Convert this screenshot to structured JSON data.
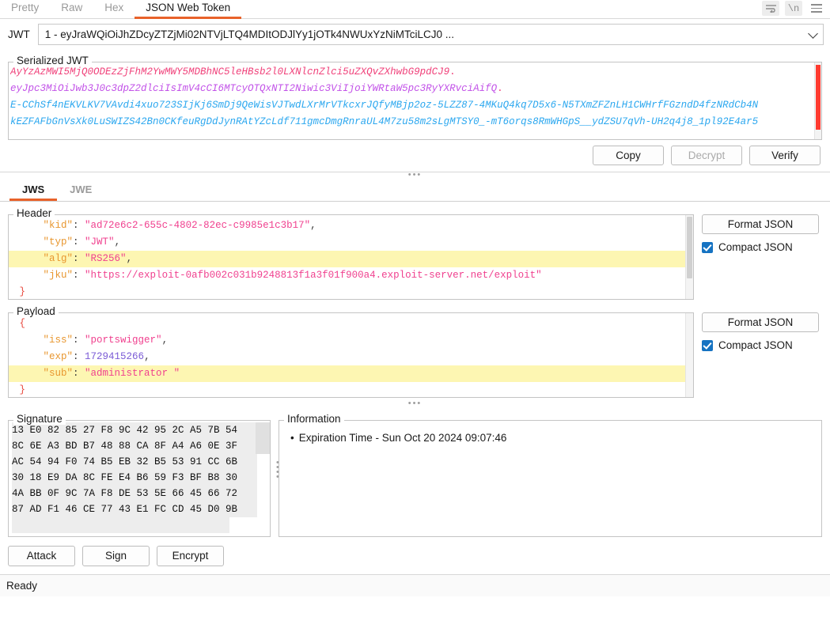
{
  "top_tabs": [
    {
      "label": "Pretty",
      "active": false
    },
    {
      "label": "Raw",
      "active": false
    },
    {
      "label": "Hex",
      "active": false
    },
    {
      "label": "JSON Web Token",
      "active": true
    }
  ],
  "top_icons": [
    {
      "name": "word-wrap-icon",
      "glyph": "↵"
    },
    {
      "name": "show-newlines-icon",
      "glyph": "\\n"
    },
    {
      "name": "menu-icon",
      "glyph": ""
    }
  ],
  "jwt_selector": {
    "label": "JWT",
    "value": "1 - eyJraWQiOiJhZDcyZTZjMi02NTVjLTQ4MDItODJlYy1jOTk4NWUxYzNiMTciLCJ0 ..."
  },
  "serialized": {
    "legend": "Serialized JWT",
    "header_b64": "AyYzAzMWI5MjQ0ODEzZjFhM2YwMWY5MDBhNC5leHBsb2l0LXNlcnZlci5uZXQvZXhwbG9pdCJ9",
    "payload_b64": "eyJpc3MiOiJwb3J0c3dpZ2dlciIsImV4cCI6MTcyOTQxNTI2Niwic3ViIjoiYWRtaW5pc3RyYXRvciAifQ",
    "signature_b64_line1": "E-CChSf4nEKVLKV7VAvdi4xuo723SIjKj6SmDj9QeWisVJTwdLXrMrVTkcxrJQfyMBjp2oz-5LZZ87-4MKuQ4kq7D5x6-N5TXmZFZnLH1CWHrfFGzndD4fzNRdCb4N",
    "signature_b64_line2": "kEZFAFbGnVsXk0LuSWIZS42Bn0CKfeuRgDdJynRAtYZcLdf711gmcDmgRnraUL4M7zu58m2sLgMTSY0_-mT6orqs8RmWHGpS__ydZSU7qVh-UH2q4j8_1pl92E4ar5"
  },
  "action_buttons": [
    {
      "label": "Copy",
      "disabled": false
    },
    {
      "label": "Decrypt",
      "disabled": true
    },
    {
      "label": "Verify",
      "disabled": false
    }
  ],
  "sub_tabs": [
    {
      "label": "JWS",
      "active": true
    },
    {
      "label": "JWE",
      "active": false
    }
  ],
  "header_section": {
    "legend": "Header",
    "format_button": "Format JSON",
    "compact_label": "Compact JSON",
    "compact_checked": true,
    "lines": [
      {
        "indent": 2,
        "key": "kid",
        "value": "\"ad72e6c2-655c-4802-82ec-c9985e1c3b17\"",
        "type": "string",
        "comma": true,
        "highlight": false
      },
      {
        "indent": 2,
        "key": "typ",
        "value": "\"JWT\"",
        "type": "string",
        "comma": true,
        "highlight": false
      },
      {
        "indent": 2,
        "key": "alg",
        "value": "\"RS256\"",
        "type": "string",
        "comma": true,
        "highlight": true
      },
      {
        "indent": 2,
        "key": "jku",
        "value": "\"https://exploit-0afb002c031b9248813f1a3f01f900a4.exploit-server.net/exploit\"",
        "type": "string",
        "comma": false,
        "highlight": false
      },
      {
        "indent": 0,
        "key": null,
        "value": "}",
        "type": "brace",
        "comma": false,
        "highlight": false
      }
    ]
  },
  "payload_section": {
    "legend": "Payload",
    "format_button": "Format JSON",
    "compact_label": "Compact JSON",
    "compact_checked": true,
    "lines": [
      {
        "indent": 0,
        "key": null,
        "value": "{",
        "type": "brace",
        "comma": false,
        "highlight": false
      },
      {
        "indent": 2,
        "key": "iss",
        "value": "\"portswigger\"",
        "type": "string",
        "comma": true,
        "highlight": false
      },
      {
        "indent": 2,
        "key": "exp",
        "value": "1729415266",
        "type": "number",
        "comma": true,
        "highlight": false
      },
      {
        "indent": 2,
        "key": "sub",
        "value": "\"administrator \"",
        "type": "string",
        "comma": false,
        "highlight": true
      },
      {
        "indent": 0,
        "key": null,
        "value": "}",
        "type": "brace",
        "comma": false,
        "highlight": false
      }
    ]
  },
  "signature_section": {
    "legend": "Signature",
    "rows": [
      "13 E0 82 85 27 F8 9C 42 95 2C A5 7B 54",
      "8C 6E A3 BD B7 48 88 CA 8F A4 A6 0E 3F",
      "AC 54 94 F0 74 B5 EB 32 B5 53 91 CC 6B",
      "30 18 E9 DA 8C FE E4 B6 59 F3 BF B8 30",
      "4A BB 0F 9C 7A F8 DE 53 5E 66 45 66 72",
      "87 AD F1 46 CE 77 43 E1 FC CD 45 D0 9B"
    ]
  },
  "information_section": {
    "legend": "Information",
    "items": [
      "Expiration Time - Sun Oct 20 2024 09:07:46"
    ]
  },
  "bottom_buttons": [
    {
      "label": "Attack"
    },
    {
      "label": "Sign"
    },
    {
      "label": "Encrypt"
    }
  ],
  "status": {
    "text": "Ready"
  },
  "colors": {
    "accent": "#e8622a",
    "checkbox": "#1673c2",
    "highlight": "#fdf6b2",
    "json_key": "#e8962e",
    "json_string": "#f0418f",
    "json_number": "#7b5bd6",
    "jwt_header": "#f0417a",
    "jwt_payload": "#c252e8",
    "jwt_signature": "#2ba7ef"
  }
}
